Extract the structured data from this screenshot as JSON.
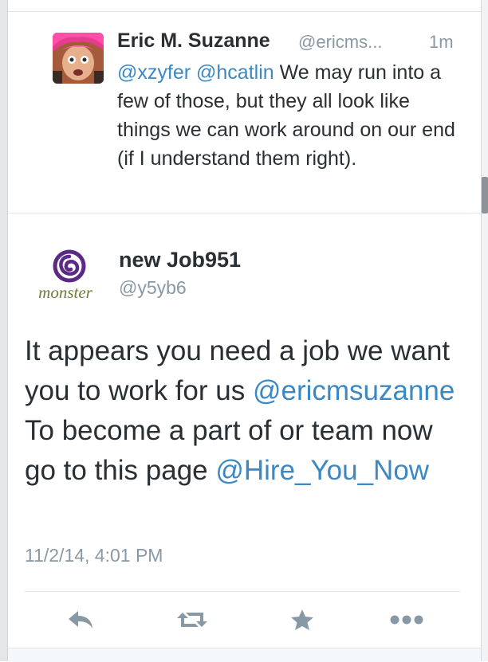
{
  "reply_tweet": {
    "name": "Eric M. Suzanne",
    "handle": "@ericms...",
    "time": "1m",
    "mentions": [
      "@xzyfer",
      "@hcatlin"
    ],
    "text": " We may run into a few of those, but they all look like things we can work around on our end (if I understand them right)."
  },
  "main_tweet": {
    "logo_text": "monster",
    "name": "new Job951",
    "handle": "@y5yb6",
    "text_part1": "It appears you need a job we want you to work for us ",
    "mention1": "@ericmsuzanne",
    "text_part2": " To become a part of or team now go to this page ",
    "mention2": "@Hire_You_Now",
    "date": "11/2/14, 4:01 PM"
  },
  "actions": [
    {
      "name": "reply",
      "icon": "reply-icon"
    },
    {
      "name": "retweet",
      "icon": "retweet-icon"
    },
    {
      "name": "favorite",
      "icon": "star-icon"
    },
    {
      "name": "more",
      "icon": "more-icon"
    }
  ],
  "colors": {
    "link": "#3b88c3",
    "muted": "#8899a6",
    "icon": "#8899a6",
    "logo_purple": "#5b2a86",
    "logo_green": "#6e7a3a"
  }
}
